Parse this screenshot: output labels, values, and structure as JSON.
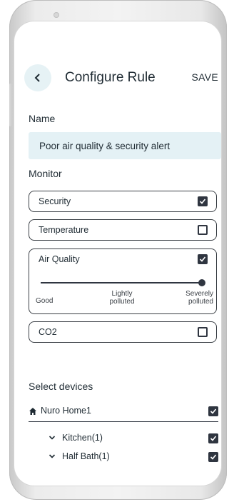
{
  "header": {
    "title": "Configure Rule",
    "save_label": "SAVE"
  },
  "name": {
    "label": "Name",
    "value": "Poor air quality & security alert"
  },
  "monitor": {
    "label": "Monitor",
    "items": [
      {
        "label": "Security",
        "checked": true
      },
      {
        "label": "Temperature",
        "checked": false
      },
      {
        "label": "Air Quality",
        "checked": true
      },
      {
        "label": "CO2",
        "checked": false
      }
    ],
    "air_quality_slider": {
      "value": 1.0,
      "labels": [
        "Good",
        "Lightly polluted",
        "Severely polluted"
      ]
    }
  },
  "devices": {
    "label": "Select devices",
    "home": {
      "label": "Nuro Home1",
      "checked": true
    },
    "rooms": [
      {
        "label": "Kitchen(1)",
        "checked": true
      },
      {
        "label": "Half Bath(1)",
        "checked": true
      }
    ]
  },
  "colors": {
    "accent": "#e4f1f5",
    "dark": "#2f3540",
    "text": "#1f2b33"
  }
}
